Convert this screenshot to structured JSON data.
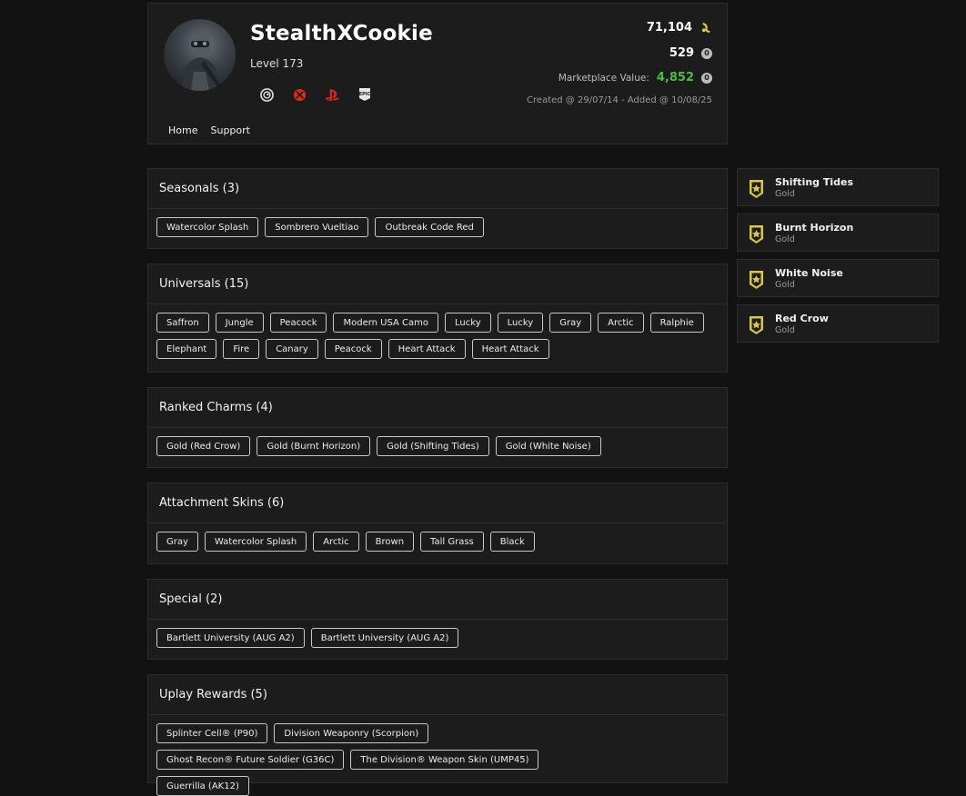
{
  "profile": {
    "username": "StealthXCookie",
    "level": "Level 173",
    "renown": "71,104",
    "credits": "529",
    "marketplace_label": "Marketplace Value:",
    "marketplace_value": "4,852",
    "created": "Created @ 29/07/14 - Added @ 10/08/25",
    "platform_icons": [
      "ubisoft-icon",
      "xbox-icon",
      "playstation-icon",
      "epic-icon"
    ],
    "nav": [
      "Home",
      "Support"
    ]
  },
  "colors": {
    "xbox": "#e0281b",
    "playstation": "#d7261b",
    "marketplace_value": "#4cbb4a",
    "rank_badge": "#d9c64a"
  },
  "sections": [
    {
      "title": "Seasonals (3)",
      "items": [
        "Watercolor Splash",
        "Sombrero Vueltiao",
        "Outbreak Code Red"
      ]
    },
    {
      "title": "Universals (15)",
      "items": [
        "Saffron",
        "Jungle",
        "Peacock",
        "Modern USA Camo",
        "Lucky",
        "Lucky",
        "Gray",
        "Arctic",
        "Ralphie",
        "Elephant",
        "Fire",
        "Canary",
        "Peacock",
        "Heart Attack",
        "Heart Attack"
      ]
    },
    {
      "title": "Ranked Charms (4)",
      "items": [
        "Gold (Red Crow)",
        "Gold (Burnt Horizon)",
        "Gold (Shifting Tides)",
        "Gold (White Noise)"
      ]
    },
    {
      "title": "Attachment Skins (6)",
      "items": [
        "Gray",
        "Watercolor Splash",
        "Arctic",
        "Brown",
        "Tall Grass",
        "Black"
      ]
    },
    {
      "title": "Special (2)",
      "items": [
        "Bartlett University (AUG A2)",
        "Bartlett University (AUG A2)"
      ]
    },
    {
      "title": "Uplay Rewards (5)",
      "items": [
        "Splinter Cell® (P90)",
        "Division Weaponry (Scorpion)",
        "Ghost Recon® Future Soldier (G36C)",
        "The Division® Weapon Skin (UMP45)",
        "Guerrilla (AK12)"
      ]
    }
  ],
  "ranks": [
    {
      "season": "Shifting Tides",
      "rank": "Gold"
    },
    {
      "season": "Burnt Horizon",
      "rank": "Gold"
    },
    {
      "season": "White Noise",
      "rank": "Gold"
    },
    {
      "season": "Red Crow",
      "rank": "Gold"
    }
  ]
}
